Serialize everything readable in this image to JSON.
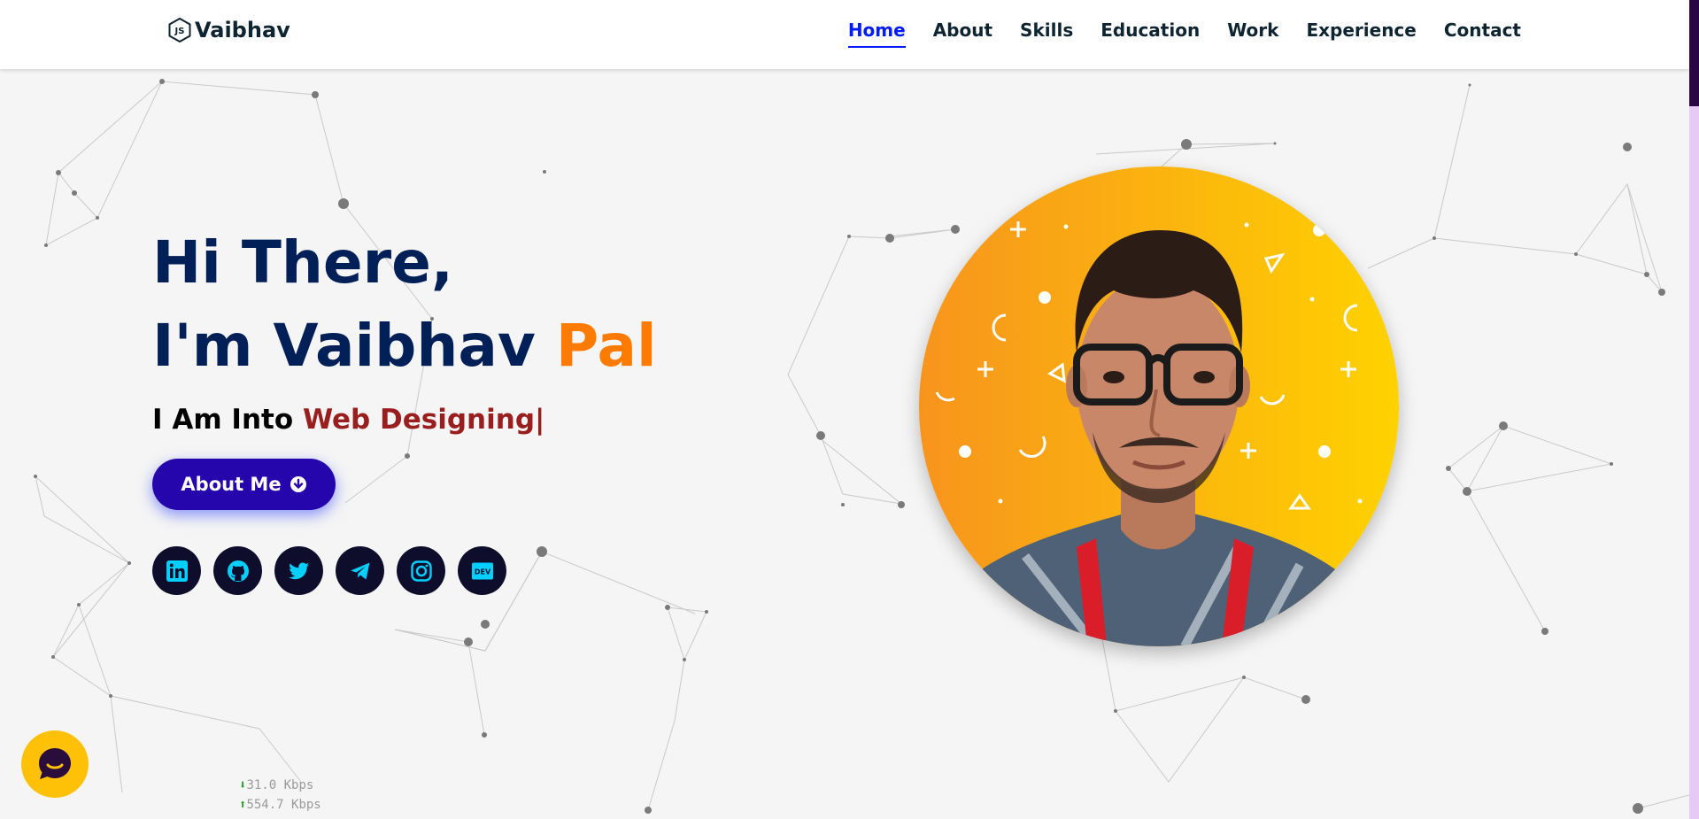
{
  "brand": {
    "logo_icon": "js-hexagon-icon",
    "name": "Vaibhav"
  },
  "nav": {
    "items": [
      {
        "label": "Home",
        "active": true
      },
      {
        "label": "About",
        "active": false
      },
      {
        "label": "Skills",
        "active": false
      },
      {
        "label": "Education",
        "active": false
      },
      {
        "label": "Work",
        "active": false
      },
      {
        "label": "Experience",
        "active": false
      },
      {
        "label": "Contact",
        "active": false
      }
    ]
  },
  "hero": {
    "greeting": "Hi There,",
    "intro_prefix": "I'm Vaibhav",
    "intro_accent": "Pal",
    "typed_prefix": "I Am Into",
    "typed_role": "Web Designing",
    "typed_cursor": "|",
    "button_label": "About Me",
    "button_icon": "arrow-circle-down-icon"
  },
  "socials": [
    {
      "name": "linkedin-icon"
    },
    {
      "name": "github-icon"
    },
    {
      "name": "twitter-icon"
    },
    {
      "name": "telegram-icon"
    },
    {
      "name": "instagram-icon"
    },
    {
      "name": "dev-icon"
    }
  ],
  "speed": {
    "download": "31.0 Kbps",
    "upload": "554.7 Kbps"
  },
  "colors": {
    "heading": "#002057",
    "accent_orange": "#ff7b00",
    "role_red": "#991e1e",
    "button": "#2506ad",
    "nav_active": "#011aff",
    "social_bg": "#0e0e2c",
    "social_icon": "#00d0ff",
    "chat_widget": "#ffc107"
  }
}
